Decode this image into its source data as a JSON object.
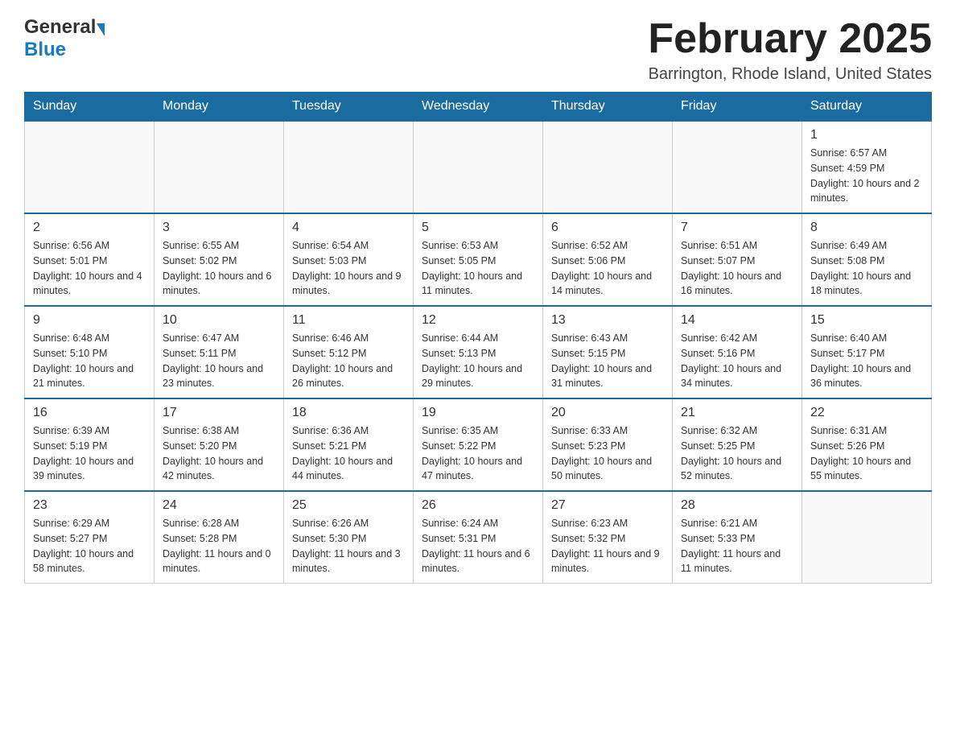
{
  "header": {
    "logo_general": "General",
    "logo_blue": "Blue",
    "month_title": "February 2025",
    "location": "Barrington, Rhode Island, United States"
  },
  "days_of_week": [
    "Sunday",
    "Monday",
    "Tuesday",
    "Wednesday",
    "Thursday",
    "Friday",
    "Saturday"
  ],
  "weeks": [
    [
      {
        "day": "",
        "info": ""
      },
      {
        "day": "",
        "info": ""
      },
      {
        "day": "",
        "info": ""
      },
      {
        "day": "",
        "info": ""
      },
      {
        "day": "",
        "info": ""
      },
      {
        "day": "",
        "info": ""
      },
      {
        "day": "1",
        "info": "Sunrise: 6:57 AM\nSunset: 4:59 PM\nDaylight: 10 hours and 2 minutes."
      }
    ],
    [
      {
        "day": "2",
        "info": "Sunrise: 6:56 AM\nSunset: 5:01 PM\nDaylight: 10 hours and 4 minutes."
      },
      {
        "day": "3",
        "info": "Sunrise: 6:55 AM\nSunset: 5:02 PM\nDaylight: 10 hours and 6 minutes."
      },
      {
        "day": "4",
        "info": "Sunrise: 6:54 AM\nSunset: 5:03 PM\nDaylight: 10 hours and 9 minutes."
      },
      {
        "day": "5",
        "info": "Sunrise: 6:53 AM\nSunset: 5:05 PM\nDaylight: 10 hours and 11 minutes."
      },
      {
        "day": "6",
        "info": "Sunrise: 6:52 AM\nSunset: 5:06 PM\nDaylight: 10 hours and 14 minutes."
      },
      {
        "day": "7",
        "info": "Sunrise: 6:51 AM\nSunset: 5:07 PM\nDaylight: 10 hours and 16 minutes."
      },
      {
        "day": "8",
        "info": "Sunrise: 6:49 AM\nSunset: 5:08 PM\nDaylight: 10 hours and 18 minutes."
      }
    ],
    [
      {
        "day": "9",
        "info": "Sunrise: 6:48 AM\nSunset: 5:10 PM\nDaylight: 10 hours and 21 minutes."
      },
      {
        "day": "10",
        "info": "Sunrise: 6:47 AM\nSunset: 5:11 PM\nDaylight: 10 hours and 23 minutes."
      },
      {
        "day": "11",
        "info": "Sunrise: 6:46 AM\nSunset: 5:12 PM\nDaylight: 10 hours and 26 minutes."
      },
      {
        "day": "12",
        "info": "Sunrise: 6:44 AM\nSunset: 5:13 PM\nDaylight: 10 hours and 29 minutes."
      },
      {
        "day": "13",
        "info": "Sunrise: 6:43 AM\nSunset: 5:15 PM\nDaylight: 10 hours and 31 minutes."
      },
      {
        "day": "14",
        "info": "Sunrise: 6:42 AM\nSunset: 5:16 PM\nDaylight: 10 hours and 34 minutes."
      },
      {
        "day": "15",
        "info": "Sunrise: 6:40 AM\nSunset: 5:17 PM\nDaylight: 10 hours and 36 minutes."
      }
    ],
    [
      {
        "day": "16",
        "info": "Sunrise: 6:39 AM\nSunset: 5:19 PM\nDaylight: 10 hours and 39 minutes."
      },
      {
        "day": "17",
        "info": "Sunrise: 6:38 AM\nSunset: 5:20 PM\nDaylight: 10 hours and 42 minutes."
      },
      {
        "day": "18",
        "info": "Sunrise: 6:36 AM\nSunset: 5:21 PM\nDaylight: 10 hours and 44 minutes."
      },
      {
        "day": "19",
        "info": "Sunrise: 6:35 AM\nSunset: 5:22 PM\nDaylight: 10 hours and 47 minutes."
      },
      {
        "day": "20",
        "info": "Sunrise: 6:33 AM\nSunset: 5:23 PM\nDaylight: 10 hours and 50 minutes."
      },
      {
        "day": "21",
        "info": "Sunrise: 6:32 AM\nSunset: 5:25 PM\nDaylight: 10 hours and 52 minutes."
      },
      {
        "day": "22",
        "info": "Sunrise: 6:31 AM\nSunset: 5:26 PM\nDaylight: 10 hours and 55 minutes."
      }
    ],
    [
      {
        "day": "23",
        "info": "Sunrise: 6:29 AM\nSunset: 5:27 PM\nDaylight: 10 hours and 58 minutes."
      },
      {
        "day": "24",
        "info": "Sunrise: 6:28 AM\nSunset: 5:28 PM\nDaylight: 11 hours and 0 minutes."
      },
      {
        "day": "25",
        "info": "Sunrise: 6:26 AM\nSunset: 5:30 PM\nDaylight: 11 hours and 3 minutes."
      },
      {
        "day": "26",
        "info": "Sunrise: 6:24 AM\nSunset: 5:31 PM\nDaylight: 11 hours and 6 minutes."
      },
      {
        "day": "27",
        "info": "Sunrise: 6:23 AM\nSunset: 5:32 PM\nDaylight: 11 hours and 9 minutes."
      },
      {
        "day": "28",
        "info": "Sunrise: 6:21 AM\nSunset: 5:33 PM\nDaylight: 11 hours and 11 minutes."
      },
      {
        "day": "",
        "info": ""
      }
    ]
  ]
}
